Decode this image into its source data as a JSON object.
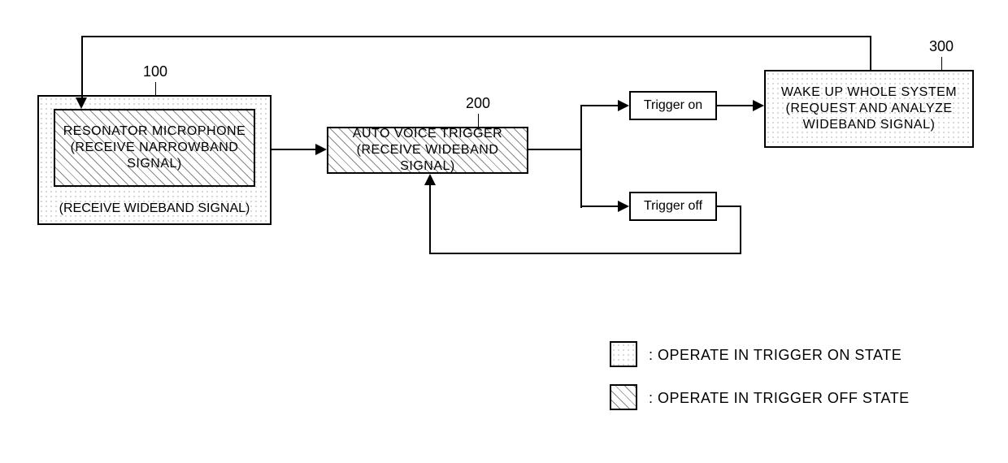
{
  "diagram": {
    "block100": {
      "number": "100",
      "inner_text": "RESONATOR MICROPHONE\n(RECEIVE NARROWBAND\nSIGNAL)",
      "outer_text": "(RECEIVE WIDEBAND SIGNAL)"
    },
    "block200": {
      "number": "200",
      "text": "AUTO VOICE TRIGGER\n(RECEIVE WIDEBAND SIGNAL)"
    },
    "block300": {
      "number": "300",
      "text": "WAKE UP WHOLE SYSTEM\n(REQUEST AND ANALYZE\nWIDEBAND SIGNAL)"
    },
    "trigger_on": "Trigger on",
    "trigger_off": "Trigger off",
    "legend": {
      "on": ": OPERATE IN TRIGGER ON STATE",
      "off": ": OPERATE IN TRIGGER OFF STATE"
    }
  }
}
